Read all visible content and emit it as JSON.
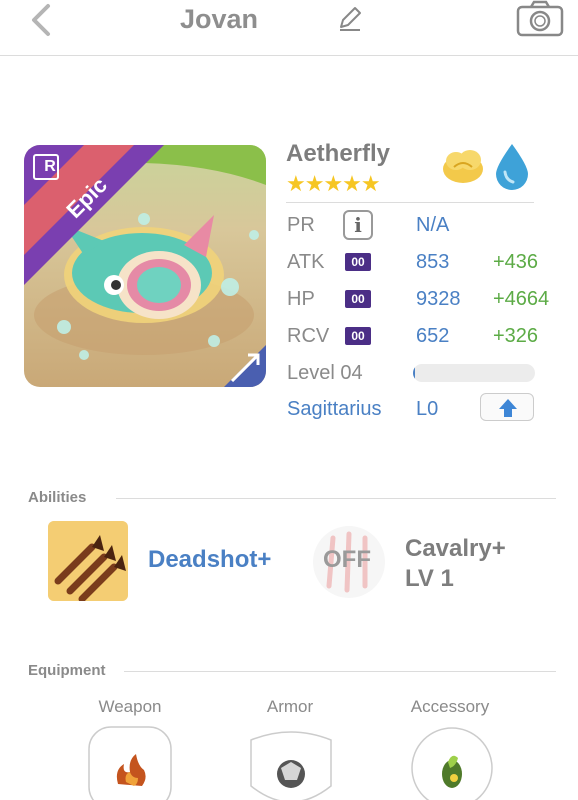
{
  "header": {
    "title": "Jovan"
  },
  "card": {
    "rarity": "Epic",
    "rank_badge": "R"
  },
  "unit": {
    "name": "Aetherfly",
    "stars": "★★★★★",
    "zodiac": "Sagittarius",
    "zodiac_level": "L0"
  },
  "stats": {
    "pr": {
      "label": "PR",
      "value": "N/A",
      "info_glyph": "i"
    },
    "atk": {
      "label": "ATK",
      "badge": "00",
      "value": "853",
      "bonus": "+436"
    },
    "hp": {
      "label": "HP",
      "badge": "00",
      "value": "9328",
      "bonus": "+4664"
    },
    "rcv": {
      "label": "RCV",
      "badge": "00",
      "value": "652",
      "bonus": "+326"
    },
    "level": {
      "label": "Level 04",
      "progress_fraction": 0.02
    }
  },
  "abilities": {
    "section_label": "Abilities",
    "primary": "Deadshot+",
    "secondary_state": "OFF",
    "secondary_name": "Cavalry+",
    "secondary_level": "LV 1"
  },
  "equipment": {
    "section_label": "Equipment",
    "slots": [
      {
        "label": "Weapon",
        "icon": "flame-weapon-icon"
      },
      {
        "label": "Armor",
        "icon": "stone-armor-icon"
      },
      {
        "label": "Accessory",
        "icon": "leaf-accessory-icon"
      }
    ]
  },
  "colors": {
    "accent_blue": "#4a80c4",
    "bonus_green": "#5cab46",
    "badge_purple": "#4b2e86",
    "star_gold": "#f6c623",
    "epic_ribbon": "#e0626a"
  }
}
